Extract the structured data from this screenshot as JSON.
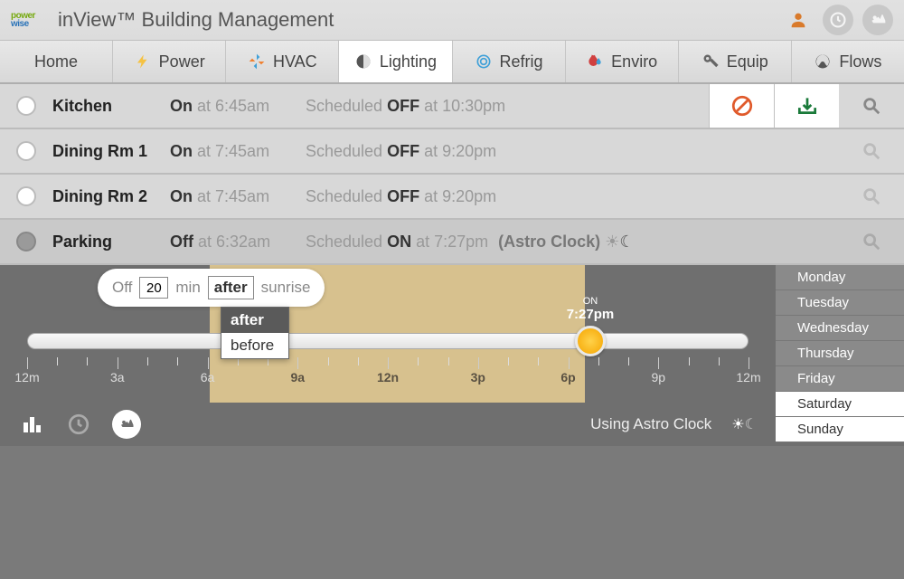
{
  "header": {
    "title": "inView™ Building Management",
    "logo_top": "power",
    "logo_bot": "wise"
  },
  "tabs": [
    {
      "label": "Home"
    },
    {
      "label": "Power"
    },
    {
      "label": "HVAC"
    },
    {
      "label": "Lighting"
    },
    {
      "label": "Refrig"
    },
    {
      "label": "Enviro"
    },
    {
      "label": "Equip"
    },
    {
      "label": "Flows"
    }
  ],
  "active_tab": "Lighting",
  "zones": [
    {
      "name": "Kitchen",
      "state": "On",
      "state_time": "at 6:45am",
      "sched_prefix": "Scheduled ",
      "sched_state": "OFF",
      "sched_suffix": " at 10:30pm",
      "astro": "",
      "actions": true
    },
    {
      "name": "Dining Rm 1",
      "state": "On",
      "state_time": "at 7:45am",
      "sched_prefix": "Scheduled ",
      "sched_state": "OFF",
      "sched_suffix": " at 9:20pm",
      "astro": "",
      "actions": false
    },
    {
      "name": "Dining Rm 2",
      "state": "On",
      "state_time": "at 7:45am",
      "sched_prefix": "Scheduled ",
      "sched_state": "OFF",
      "sched_suffix": " at 9:20pm",
      "astro": "",
      "actions": false
    },
    {
      "name": "Parking",
      "state": "Off",
      "state_time": "at 6:32am",
      "sched_prefix": "Scheduled ",
      "sched_state": "ON",
      "sched_suffix": " at 7:27pm",
      "astro": "(Astro Clock)",
      "actions": false,
      "selected": true
    }
  ],
  "editor": {
    "pill": {
      "prefix": "Off",
      "value": "20",
      "unit": "min",
      "relation": "after",
      "anchor": "sunrise"
    },
    "dropdown": {
      "options": [
        "after",
        "before"
      ],
      "selected": "after"
    },
    "on_handle": {
      "label_top": "ON",
      "label_time": "7:27pm",
      "position_pct": 77
    },
    "time_labels": [
      "12m",
      "3a",
      "6a",
      "9a",
      "12n",
      "3p",
      "6p",
      "9p",
      "12m"
    ],
    "footer_text": "Using Astro Clock"
  },
  "days": [
    "Monday",
    "Tuesday",
    "Wednesday",
    "Thursday",
    "Friday",
    "Saturday",
    "Sunday"
  ],
  "active_days": [
    "Saturday",
    "Sunday"
  ]
}
